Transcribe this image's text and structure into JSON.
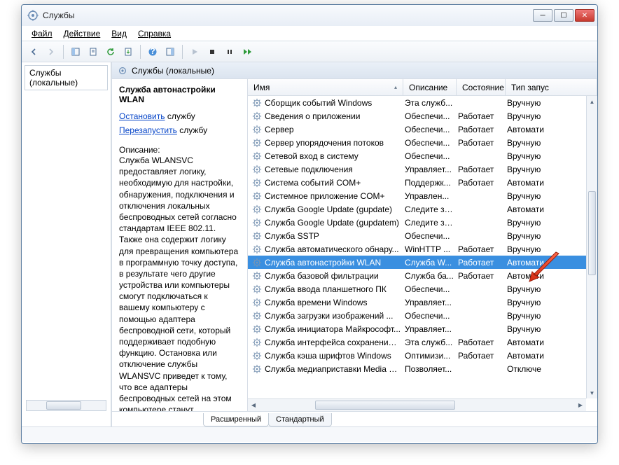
{
  "window": {
    "title": "Службы"
  },
  "menu": {
    "file": "Файл",
    "action": "Действие",
    "view": "Вид",
    "help": "Справка"
  },
  "leftpane": {
    "header": "Службы (локальные)"
  },
  "rp_header": "Службы (локальные)",
  "details": {
    "service_name": "Служба автонастройки WLAN",
    "stop_link": "Остановить",
    "stop_suffix": " службу",
    "restart_link": "Перезапустить",
    "restart_suffix": " службу",
    "desc_label": "Описание:",
    "desc_text": "Служба WLANSVC предоставляет логику, необходимую для настройки, обнаружения, подключения и отключения локальных беспроводных сетей согласно стандартам IEEE 802.11. Также она содержит логику для превращения компьютера в программную точку доступа, в результате чего другие устройства или компьютеры смогут подключаться к вашему компьютеру с помощью адаптера беспроводной сети, который поддерживает подобную функцию. Остановка или отключение службы WLANSVC приведет к тому, что все адаптеры беспроводных сетей на этом компьютере станут недоступными из раздела"
  },
  "columns": {
    "name": "Имя",
    "desc": "Описание",
    "status": "Состояние",
    "startup": "Тип запус"
  },
  "tabs": {
    "extended": "Расширенный",
    "standard": "Стандартный"
  },
  "services": [
    {
      "name": "Сборщик событий Windows",
      "desc": "Эта служб...",
      "status": "",
      "startup": "Вручную"
    },
    {
      "name": "Сведения о приложении",
      "desc": "Обеспечи...",
      "status": "Работает",
      "startup": "Вручную"
    },
    {
      "name": "Сервер",
      "desc": "Обеспечи...",
      "status": "Работает",
      "startup": "Автомати"
    },
    {
      "name": "Сервер упорядочения потоков",
      "desc": "Обеспечи...",
      "status": "Работает",
      "startup": "Вручную"
    },
    {
      "name": "Сетевой вход в систему",
      "desc": "Обеспечи...",
      "status": "",
      "startup": "Вручную"
    },
    {
      "name": "Сетевые подключения",
      "desc": "Управляет...",
      "status": "Работает",
      "startup": "Вручную"
    },
    {
      "name": "Система событий COM+",
      "desc": "Поддержк...",
      "status": "Работает",
      "startup": "Автомати"
    },
    {
      "name": "Системное приложение COM+",
      "desc": "Управлен...",
      "status": "",
      "startup": "Вручную"
    },
    {
      "name": "Служба Google Update (gupdate)",
      "desc": "Следите за...",
      "status": "",
      "startup": "Автомати"
    },
    {
      "name": "Служба Google Update (gupdatem)",
      "desc": "Следите за...",
      "status": "",
      "startup": "Вручную"
    },
    {
      "name": "Служба SSTP",
      "desc": "Обеспечи...",
      "status": "",
      "startup": "Вручную"
    },
    {
      "name": "Служба автоматического обнару...",
      "desc": "WinHTTP ...",
      "status": "Работает",
      "startup": "Вручную"
    },
    {
      "name": "Служба автонастройки WLAN",
      "desc": "Служба W...",
      "status": "Работает",
      "startup": "Автомати",
      "selected": true
    },
    {
      "name": "Служба базовой фильтрации",
      "desc": "Служба ба...",
      "status": "Работает",
      "startup": "Автомати"
    },
    {
      "name": "Служба ввода планшетного ПК",
      "desc": "Обеспечи...",
      "status": "",
      "startup": "Вручную"
    },
    {
      "name": "Служба времени Windows",
      "desc": "Управляет...",
      "status": "",
      "startup": "Вручную"
    },
    {
      "name": "Служба загрузки изображений ...",
      "desc": "Обеспечи...",
      "status": "",
      "startup": "Вручную"
    },
    {
      "name": "Служба инициатора Майкрософт...",
      "desc": "Управляет...",
      "status": "",
      "startup": "Вручную"
    },
    {
      "name": "Служба интерфейса сохранения ...",
      "desc": "Эта служб...",
      "status": "Работает",
      "startup": "Автомати"
    },
    {
      "name": "Служба кэша шрифтов Windows",
      "desc": "Оптимизи...",
      "status": "Работает",
      "startup": "Автомати"
    },
    {
      "name": "Служба медиаприставки Media C...",
      "desc": "Позволяет...",
      "status": "",
      "startup": "Отключе"
    }
  ]
}
